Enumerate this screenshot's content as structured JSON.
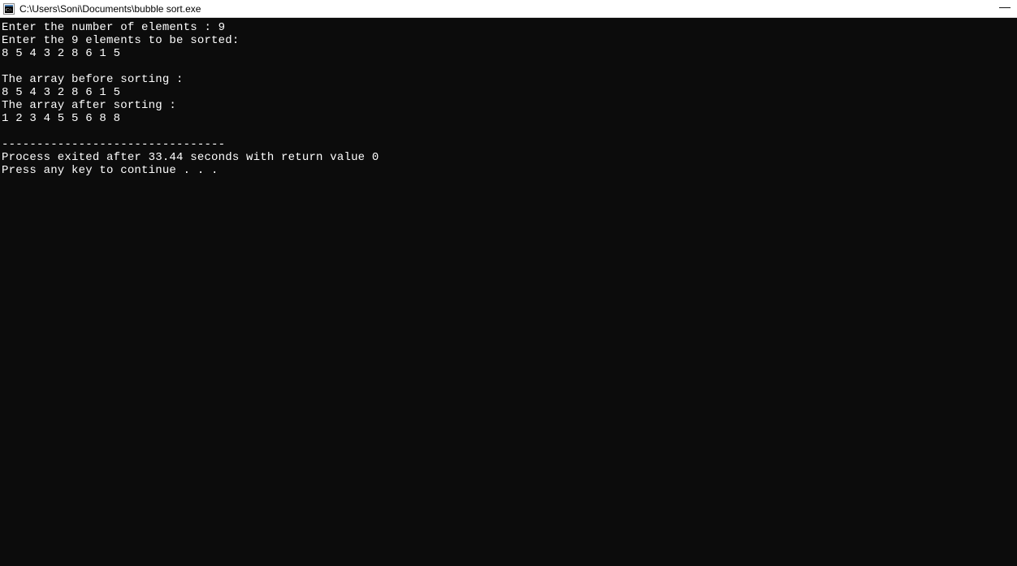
{
  "titlebar": {
    "title": "C:\\Users\\Soni\\Documents\\bubble sort.exe"
  },
  "console": {
    "lines": [
      "Enter the number of elements : 9",
      "Enter the 9 elements to be sorted:",
      "8 5 4 3 2 8 6 1 5",
      "",
      "The array before sorting :",
      "8 5 4 3 2 8 6 1 5",
      "The array after sorting :",
      "1 2 3 4 5 5 6 8 8",
      "",
      "--------------------------------",
      "Process exited after 33.44 seconds with return value 0",
      "Press any key to continue . . ."
    ]
  }
}
